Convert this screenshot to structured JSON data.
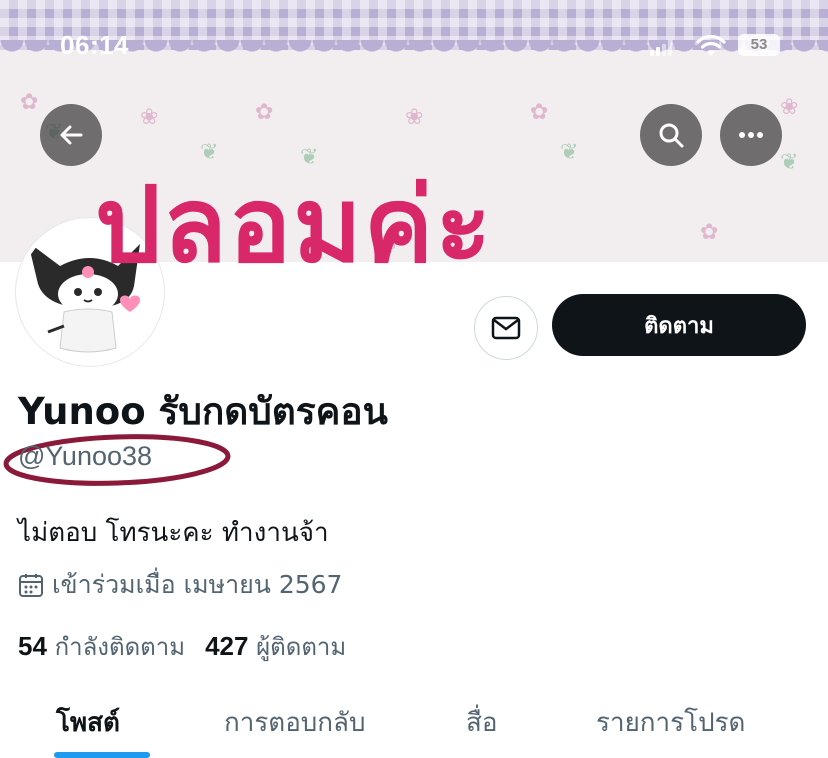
{
  "status_bar": {
    "time": "06:14",
    "battery": "53"
  },
  "overlay": {
    "text": "ปลอมค่ะ",
    "color": "#d8286a"
  },
  "profile": {
    "follow_label": "ติดตาม",
    "display_name": "Yunoo รับกดบัตรคอน",
    "handle": "@Yunoo38",
    "bio": "ไม่ตอบ โทรนะคะ ทำงานจ้า",
    "joined": "เข้าร่วมเมื่อ เมษายน 2567",
    "following_count": "54",
    "following_label": "กำลังติดตาม",
    "followers_count": "427",
    "followers_label": "ผู้ติดตาม"
  },
  "tabs": [
    {
      "label": "โพสต์",
      "active": true
    },
    {
      "label": "การตอบกลับ",
      "active": false
    },
    {
      "label": "สื่อ",
      "active": false
    },
    {
      "label": "รายการโปรด",
      "active": false
    }
  ],
  "colors": {
    "accent": "#1d9bf0",
    "annotation": "#8b1a3a",
    "follow_button": "#0f1419"
  },
  "icons": [
    "back-arrow-icon",
    "search-icon",
    "more-icon",
    "mail-icon",
    "calendar-icon",
    "signal-icon",
    "wifi-icon",
    "battery-icon"
  ]
}
